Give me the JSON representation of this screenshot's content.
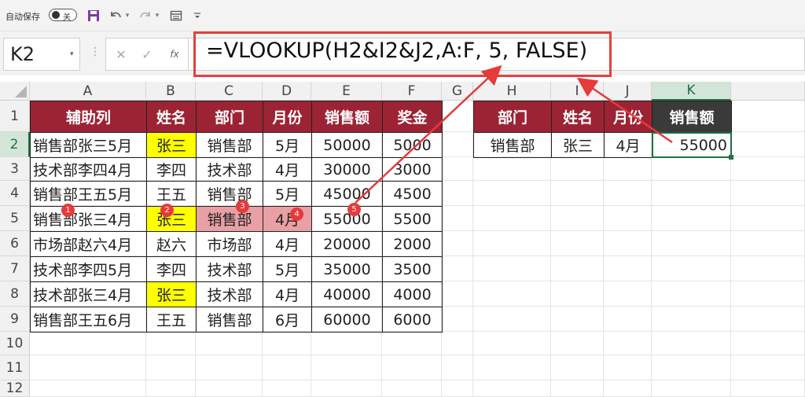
{
  "toolbar": {
    "autosave_label": "自动保存",
    "autosave_state": "关",
    "icons": [
      "save-icon",
      "undo-icon",
      "redo-icon",
      "print-preview-icon",
      "customize-icon"
    ]
  },
  "formula_bar": {
    "name_box": "K2",
    "formula": "=VLOOKUP(H2&I2&J2,A:F, 5, FALSE)",
    "highlight_color": "#e3413f"
  },
  "columns": [
    "A",
    "B",
    "C",
    "D",
    "E",
    "F",
    "G",
    "H",
    "I",
    "J",
    "K"
  ],
  "rows": [
    "1",
    "2",
    "3",
    "4",
    "5",
    "6",
    "7",
    "8",
    "9",
    "10",
    "11",
    "12"
  ],
  "source_table": {
    "headers": [
      "辅助列",
      "姓名",
      "部门",
      "月份",
      "销售额",
      "奖金"
    ],
    "rows": [
      [
        "销售部张三5月",
        "张三",
        "销售部",
        "5月",
        "50000",
        "5000"
      ],
      [
        "技术部李四4月",
        "李四",
        "技术部",
        "4月",
        "30000",
        "3000"
      ],
      [
        "销售部王五5月",
        "王五",
        "销售部",
        "5月",
        "45000",
        "4500"
      ],
      [
        "销售部张三4月",
        "张三",
        "销售部",
        "4月",
        "55000",
        "5500"
      ],
      [
        "市场部赵六4月",
        "赵六",
        "市场部",
        "4月",
        "20000",
        "2000"
      ],
      [
        "技术部李四5月",
        "李四",
        "技术部",
        "5月",
        "35000",
        "3500"
      ],
      [
        "技术部张三4月",
        "张三",
        "技术部",
        "4月",
        "40000",
        "4000"
      ],
      [
        "销售部王五6月",
        "王五",
        "销售部",
        "6月",
        "60000",
        "6000"
      ]
    ]
  },
  "lookup_table": {
    "headers": [
      "部门",
      "姓名",
      "月份",
      "销售额"
    ],
    "row": [
      "销售部",
      "张三",
      "4月",
      "55000"
    ]
  },
  "badges": [
    "1",
    "2",
    "3",
    "4",
    "5"
  ],
  "colors": {
    "header_red": "#9c2334",
    "header_dark": "#3a3a3a",
    "highlight_yellow": "#ffff00",
    "highlight_pink": "#e8a0a4",
    "annotation_red": "#e53b3b",
    "active_cell": "#1e7145"
  }
}
